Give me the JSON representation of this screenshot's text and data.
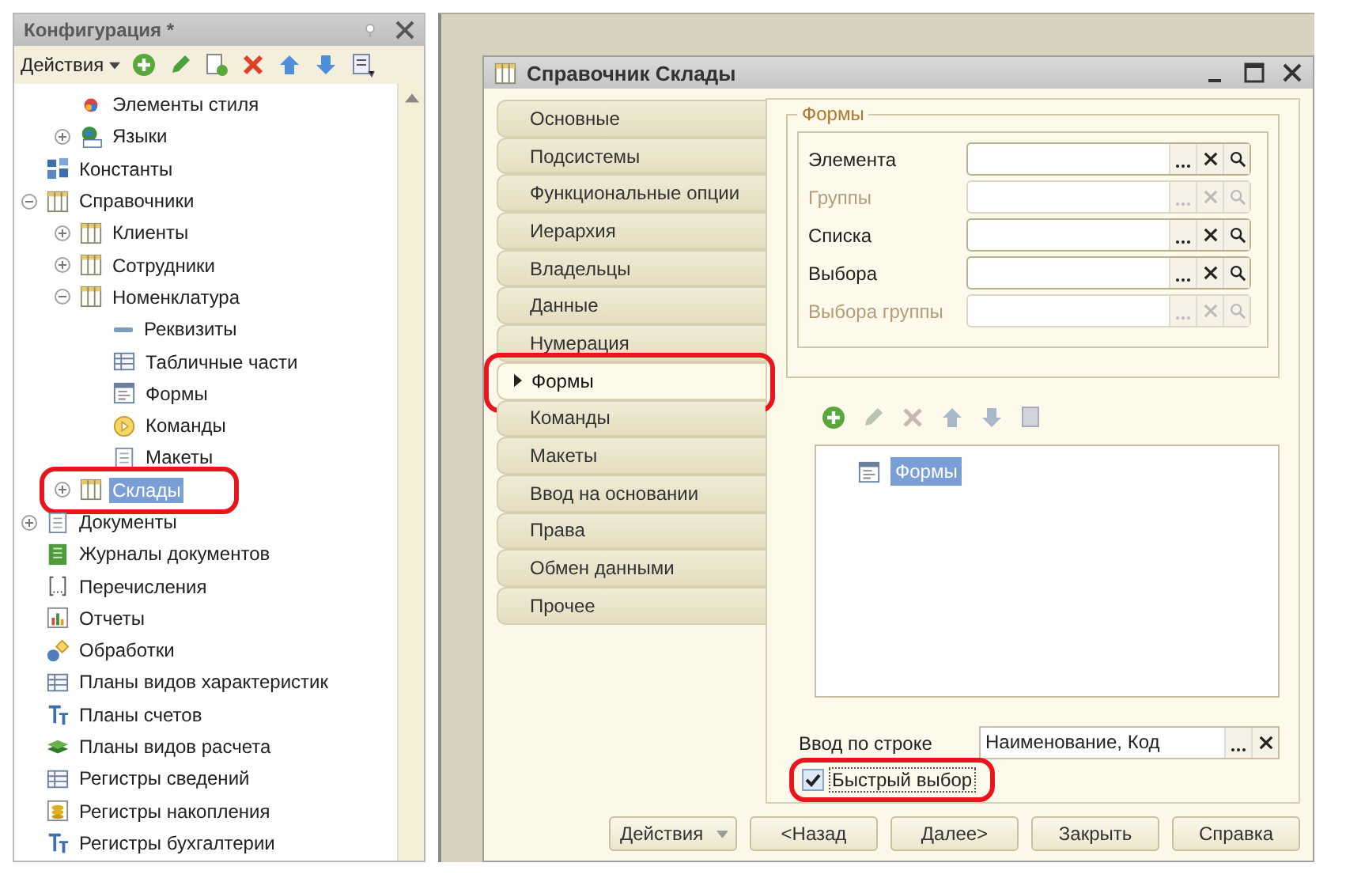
{
  "config_panel": {
    "title": "Конфигурация *",
    "toolbar": {
      "actions": "Действия"
    },
    "tree": [
      {
        "children": [
          {
            "label": "Элементы стиля",
            "kind": "style",
            "selected": false
          },
          {
            "label": "Языки",
            "kind": "languages",
            "expanded": false,
            "selected": false
          }
        ]
      },
      {
        "label": "Константы",
        "kind": "constants",
        "selected": false
      },
      {
        "label": "Справочники",
        "kind": "catalog",
        "expanded": true,
        "selected": false,
        "children": [
          {
            "label": "Клиенты",
            "kind": "catalog",
            "expanded": false,
            "selected": false
          },
          {
            "label": "Сотрудники",
            "kind": "catalog",
            "expanded": false,
            "selected": false
          },
          {
            "label": "Номенклатура",
            "kind": "catalog",
            "expanded": true,
            "selected": false,
            "children": [
              {
                "label": "Реквизиты",
                "kind": "attributes",
                "selected": false
              },
              {
                "label": "Табличные части",
                "kind": "tabular",
                "selected": false
              },
              {
                "label": "Формы",
                "kind": "forms",
                "selected": false
              },
              {
                "label": "Команды",
                "kind": "commands",
                "selected": false
              },
              {
                "label": "Макеты",
                "kind": "templates",
                "selected": false
              }
            ]
          },
          {
            "label": "Склады",
            "kind": "catalog",
            "expanded": false,
            "selected": true
          }
        ]
      },
      {
        "label": "Документы",
        "kind": "documents",
        "expanded": false,
        "selected": false
      },
      {
        "label": "Журналы документов",
        "kind": "journals",
        "selected": false
      },
      {
        "label": "Перечисления",
        "kind": "enums",
        "selected": false
      },
      {
        "label": "Отчеты",
        "kind": "reports",
        "selected": false
      },
      {
        "label": "Обработки",
        "kind": "processing",
        "selected": false
      },
      {
        "label": "Планы видов характеристик",
        "kind": "char_plans",
        "selected": false
      },
      {
        "label": "Планы счетов",
        "kind": "accounts",
        "selected": false
      },
      {
        "label": "Планы видов расчета",
        "kind": "calc_plans",
        "selected": false
      },
      {
        "label": "Регистры сведений",
        "kind": "info_registers",
        "selected": false
      },
      {
        "label": "Регистры накопления",
        "kind": "accum_registers",
        "selected": false
      },
      {
        "label": "Регистры бухгалтерии",
        "kind": "accounts",
        "selected": false
      }
    ]
  },
  "dialog": {
    "title": "Справочник Склады",
    "tabs": [
      {
        "label": "Основные",
        "selected": false
      },
      {
        "label": "Подсистемы",
        "selected": false
      },
      {
        "label": "Функциональные опции",
        "selected": false
      },
      {
        "label": "Иерархия",
        "selected": false
      },
      {
        "label": "Владельцы",
        "selected": false
      },
      {
        "label": "Данные",
        "selected": false
      },
      {
        "label": "Нумерация",
        "selected": false
      },
      {
        "label": "Формы",
        "selected": true
      },
      {
        "label": "Команды",
        "selected": false
      },
      {
        "label": "Макеты",
        "selected": false
      },
      {
        "label": "Ввод на основании",
        "selected": false
      },
      {
        "label": "Права",
        "selected": false
      },
      {
        "label": "Обмен данными",
        "selected": false
      },
      {
        "label": "Прочее",
        "selected": false
      }
    ],
    "forms_group": {
      "title": "Формы",
      "fields": [
        {
          "label": "Элемента",
          "disabled": false
        },
        {
          "label": "Группы",
          "disabled": true
        },
        {
          "label": "Списка",
          "disabled": false
        },
        {
          "label": "Выбора",
          "disabled": false
        },
        {
          "label": "Выбора группы",
          "disabled": true
        }
      ]
    },
    "forms_list": [
      {
        "label": "Формы",
        "selected": true
      }
    ],
    "input_by_string": {
      "label": "Ввод по строке",
      "value": "Наименование, Код"
    },
    "quick_choice": {
      "label": "Быстрый выбор",
      "checked": true
    },
    "buttons": [
      {
        "label": "Действия",
        "kind": "menu"
      },
      {
        "label": "<Назад",
        "kind": "plain"
      },
      {
        "label": "Далее>",
        "kind": "plain"
      },
      {
        "label": "Закрыть",
        "kind": "plain"
      },
      {
        "label": "Справка",
        "kind": "plain"
      }
    ]
  }
}
